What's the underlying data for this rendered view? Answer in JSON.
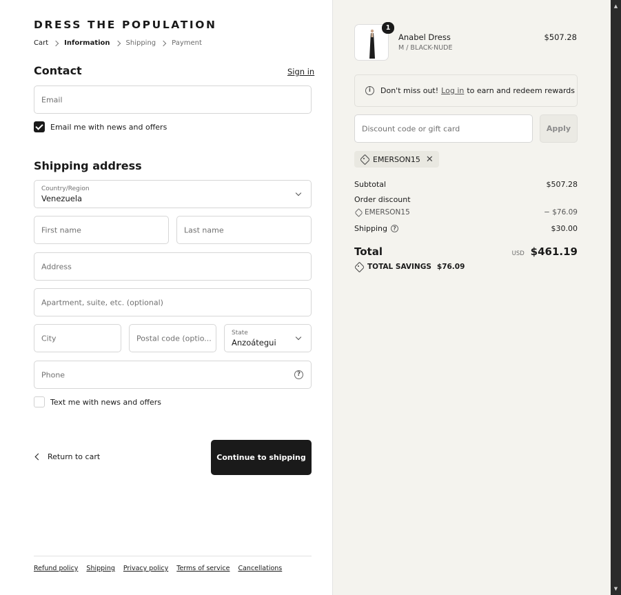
{
  "brand": "DRESS THE POPULATION",
  "breadcrumb": [
    "Cart",
    "Information",
    "Shipping",
    "Payment"
  ],
  "contact": {
    "title": "Contact",
    "signin": "Sign in",
    "email_placeholder": "Email",
    "news_label": "Email me with news and offers",
    "news_checked": true
  },
  "shipping": {
    "title": "Shipping address",
    "country_label": "Country/Region",
    "country_value": "Venezuela",
    "first_name": "First name",
    "last_name": "Last name",
    "address": "Address",
    "apartment": "Apartment, suite, etc. (optional)",
    "city": "City",
    "postal": "Postal code (optio...",
    "state_label": "State",
    "state_value": "Anzoátegui",
    "phone": "Phone",
    "sms_label": "Text me with news and offers",
    "sms_checked": false
  },
  "actions": {
    "return": "Return to cart",
    "continue": "Continue to shipping"
  },
  "footer": [
    "Refund policy",
    "Shipping",
    "Privacy policy",
    "Terms of service",
    "Cancellations"
  ],
  "order": {
    "item": {
      "name": "Anabel Dress",
      "variant": "M / BLACK-NUDE",
      "price": "$507.28",
      "quantity": "1"
    },
    "notice": {
      "before": "Don't miss out!",
      "link": "Log in",
      "after": "to earn and redeem rewards"
    },
    "discount_placeholder": "Discount code or gift card",
    "apply": "Apply",
    "code": "EMERSON15",
    "subtotal_label": "Subtotal",
    "subtotal": "$507.28",
    "order_discount_label": "Order discount",
    "discount_code": "EMERSON15",
    "discount_amount": "− $76.09",
    "shipping_label": "Shipping",
    "shipping": "$30.00",
    "total_label": "Total",
    "currency": "USD",
    "total": "$461.19",
    "savings_label": "TOTAL SAVINGS",
    "savings": "$76.09"
  },
  "colors": {
    "button_dark": "#1a1a1a",
    "sidebar_bg": "#f4f3ee"
  }
}
